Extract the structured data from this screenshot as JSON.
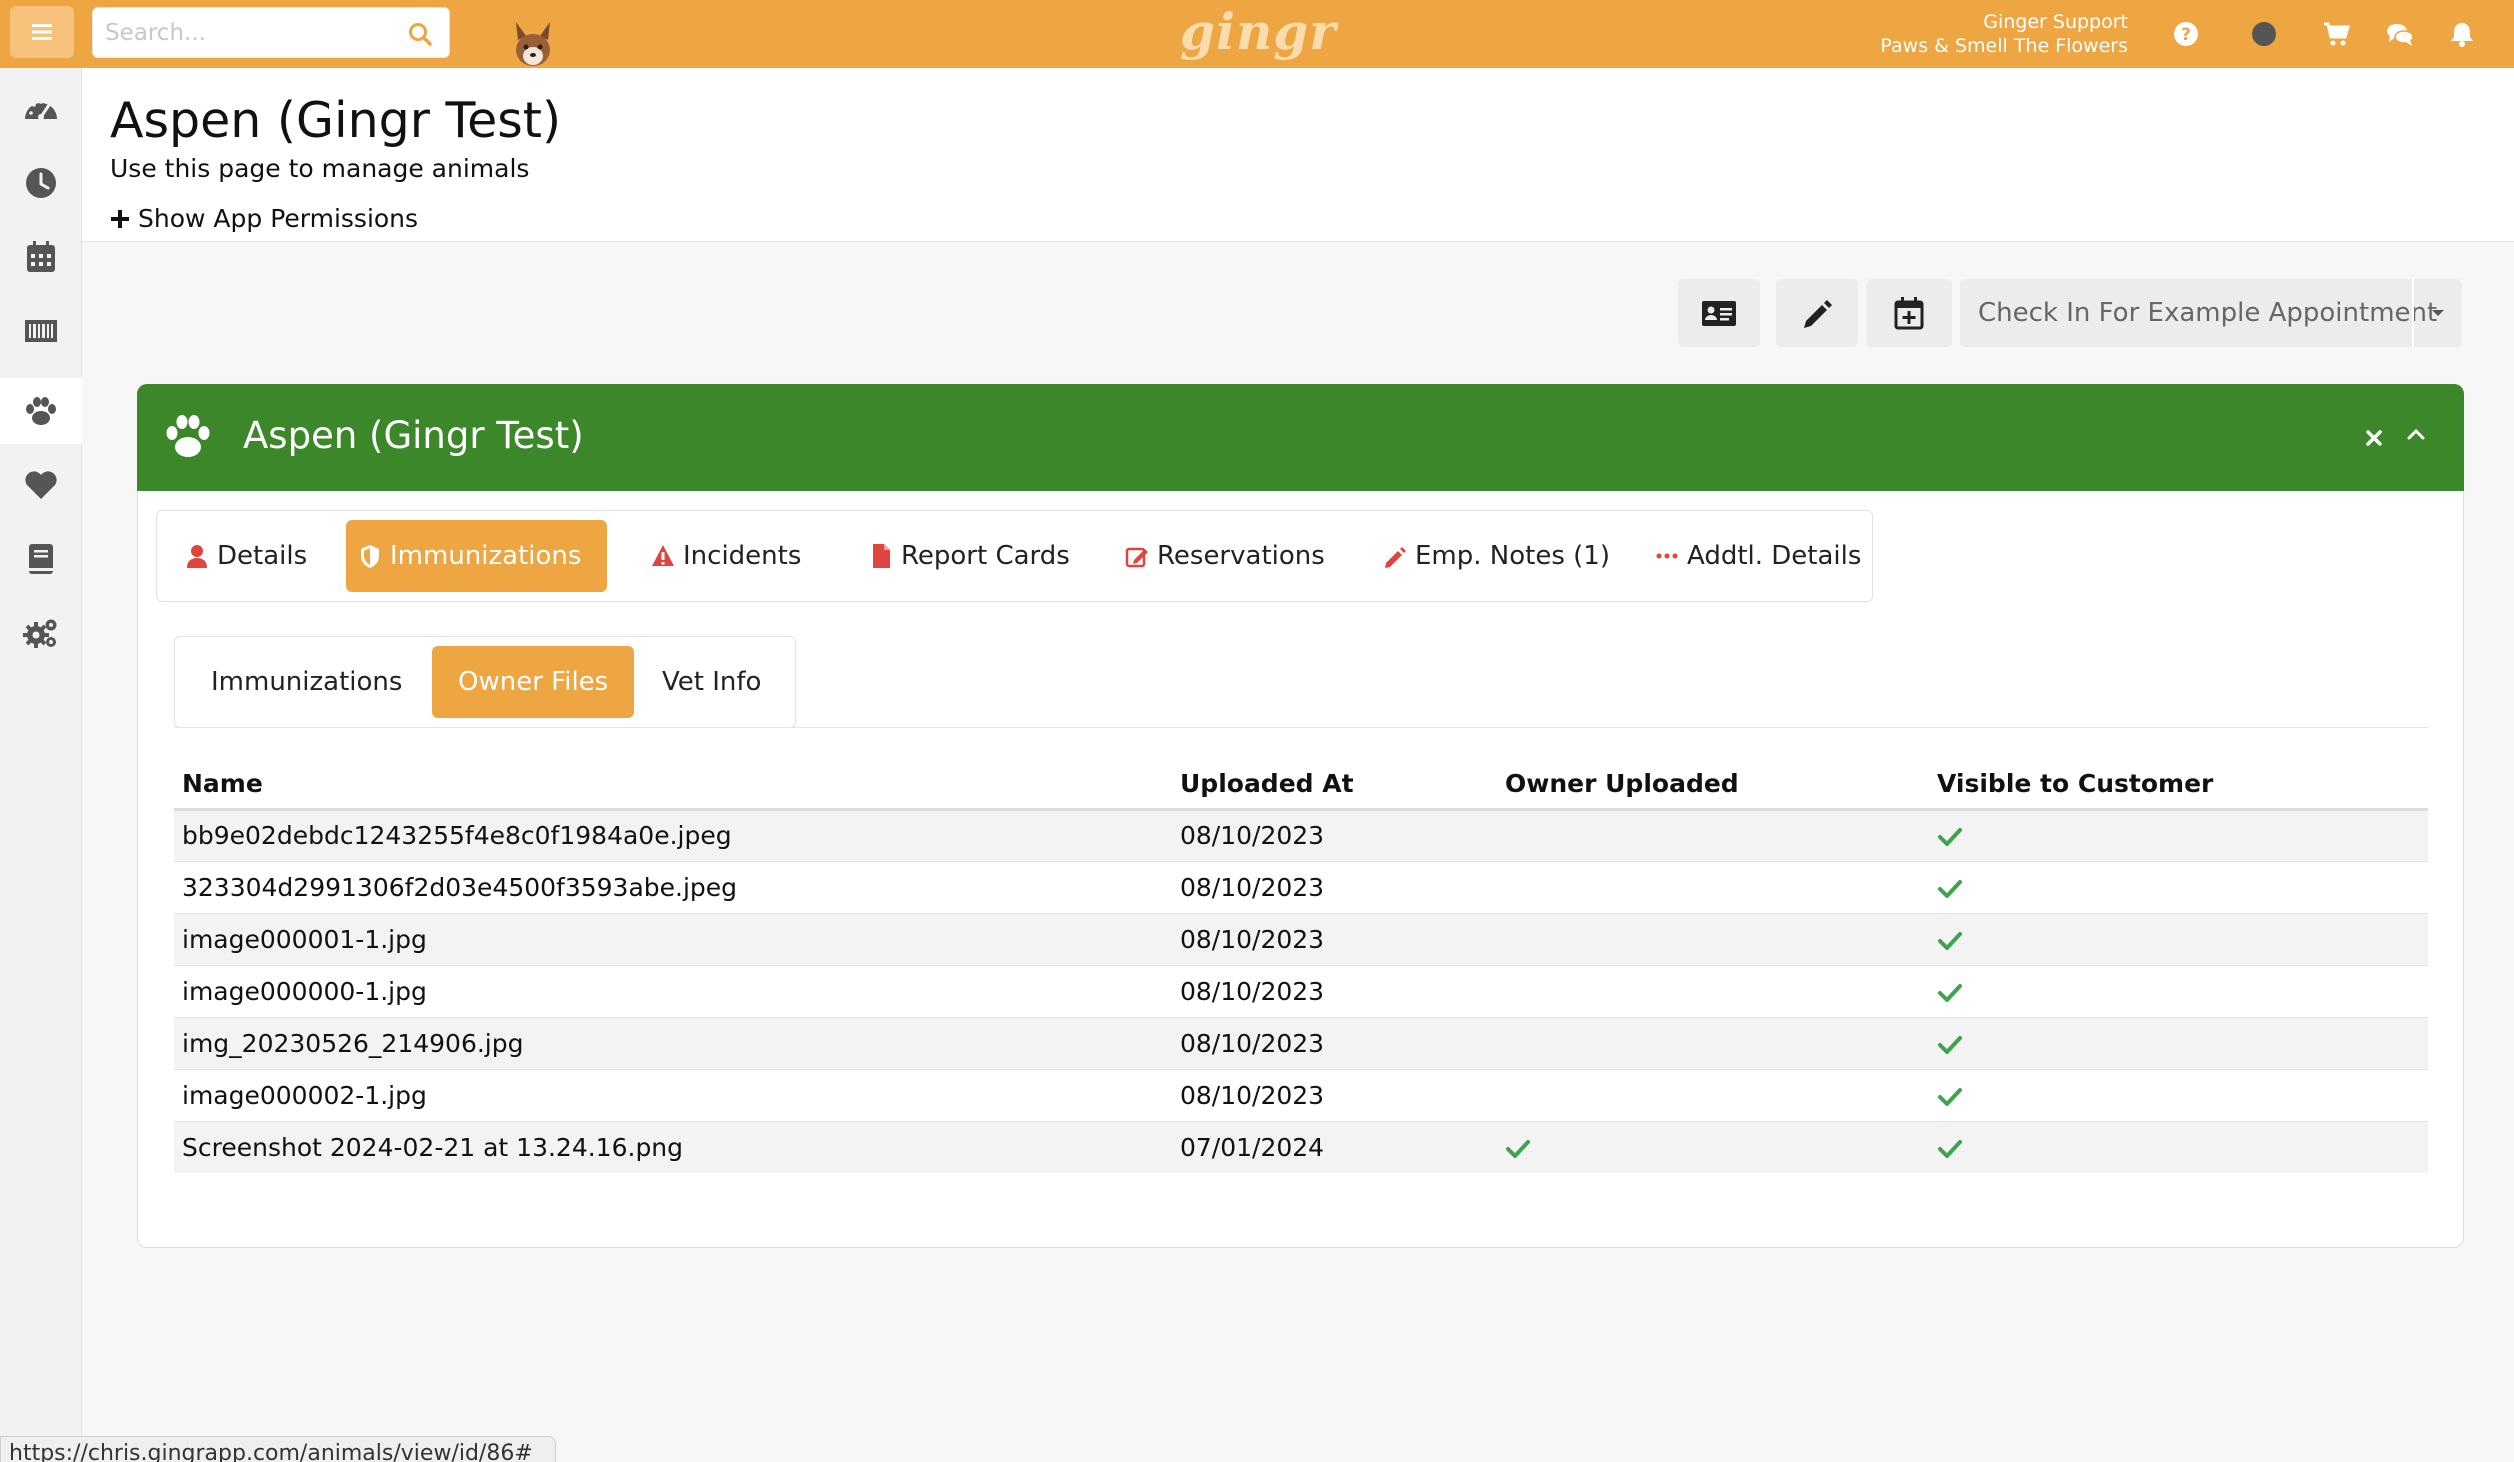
{
  "topbar": {
    "search_placeholder": "Search...",
    "logo_text": "gingr",
    "user_name": "Ginger Support",
    "location": "Paws & Smell The Flowers",
    "brand_color": "#eea642",
    "icons": [
      "help-icon",
      "status-dot-icon",
      "cart-icon",
      "chat-icon",
      "bell-icon"
    ]
  },
  "sidebar": {
    "items": [
      {
        "name": "dashboard",
        "icon": "speedometer-icon"
      },
      {
        "name": "clock",
        "icon": "clock-icon"
      },
      {
        "name": "calendar",
        "icon": "calendar-icon"
      },
      {
        "name": "barcode",
        "icon": "barcode-icon"
      },
      {
        "name": "animals",
        "icon": "paw-icon",
        "active": true
      },
      {
        "name": "favorites",
        "icon": "heart-icon"
      },
      {
        "name": "reports",
        "icon": "book-icon"
      },
      {
        "name": "settings",
        "icon": "gears-icon"
      }
    ]
  },
  "header": {
    "title": "Aspen (Gingr Test)",
    "subtitle": "Use this page to manage animals",
    "permissions_link": "Show App Permissions"
  },
  "actions": {
    "icons": [
      "id-card-icon",
      "pencil-icon",
      "calendar-plus-icon"
    ],
    "checkin_label": "Check In For Example Appointment"
  },
  "panel": {
    "title": "Aspen (Gingr Test)",
    "header_color": "#3b872a",
    "tabs": [
      {
        "label": "Details",
        "icon": "user-icon"
      },
      {
        "label": "Immunizations",
        "icon": "shield-icon",
        "active": true
      },
      {
        "label": "Incidents",
        "icon": "warning-icon"
      },
      {
        "label": "Report Cards",
        "icon": "file-icon"
      },
      {
        "label": "Reservations",
        "icon": "edit-icon"
      },
      {
        "label": "Emp. Notes (1)",
        "icon": "pencil-icon"
      },
      {
        "label": "Addtl. Details",
        "icon": "ellipsis-icon"
      }
    ],
    "subtabs": [
      {
        "label": "Immunizations"
      },
      {
        "label": "Owner Files",
        "active": true
      },
      {
        "label": "Vet Info"
      }
    ],
    "table": {
      "columns": [
        "Name",
        "Uploaded At",
        "Owner Uploaded",
        "Visible to Customer"
      ],
      "rows": [
        {
          "name": "bb9e02debdc1243255f4e8c0f1984a0e.jpeg",
          "uploaded_at": "08/10/2023",
          "owner_uploaded": false,
          "visible": true
        },
        {
          "name": "323304d2991306f2d03e4500f3593abe.jpeg",
          "uploaded_at": "08/10/2023",
          "owner_uploaded": false,
          "visible": true
        },
        {
          "name": "image000001-1.jpg",
          "uploaded_at": "08/10/2023",
          "owner_uploaded": false,
          "visible": true
        },
        {
          "name": "image000000-1.jpg",
          "uploaded_at": "08/10/2023",
          "owner_uploaded": false,
          "visible": true
        },
        {
          "name": "img_20230526_214906.jpg",
          "uploaded_at": "08/10/2023",
          "owner_uploaded": false,
          "visible": true
        },
        {
          "name": "image000002-1.jpg",
          "uploaded_at": "08/10/2023",
          "owner_uploaded": false,
          "visible": true
        },
        {
          "name": "Screenshot 2024-02-21 at 13.24.16.png",
          "uploaded_at": "07/01/2024",
          "owner_uploaded": true,
          "visible": true
        }
      ]
    }
  },
  "statusbar": {
    "url": "https://chris.gingrapp.com/animals/view/id/86#"
  }
}
